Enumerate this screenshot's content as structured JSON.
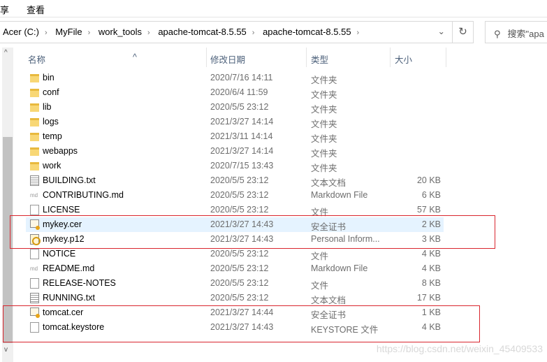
{
  "ribbon": {
    "tabs": [
      "享",
      "查看"
    ]
  },
  "address": {
    "crumbs": [
      "Acer (C:)",
      "MyFile",
      "work_tools",
      "apache-tomcat-8.5.55",
      "apache-tomcat-8.5.55"
    ],
    "search_placeholder": "搜索\"apa"
  },
  "columns": {
    "name": "名称",
    "date": "修改日期",
    "type": "类型",
    "size": "大小"
  },
  "files": [
    {
      "name": "bin",
      "date": "2020/7/16 14:11",
      "type": "文件夹",
      "size": "",
      "icon": "folder"
    },
    {
      "name": "conf",
      "date": "2020/6/4 11:59",
      "type": "文件夹",
      "size": "",
      "icon": "folder"
    },
    {
      "name": "lib",
      "date": "2020/5/5 23:12",
      "type": "文件夹",
      "size": "",
      "icon": "folder"
    },
    {
      "name": "logs",
      "date": "2021/3/27 14:14",
      "type": "文件夹",
      "size": "",
      "icon": "folder"
    },
    {
      "name": "temp",
      "date": "2021/3/11 14:14",
      "type": "文件夹",
      "size": "",
      "icon": "folder"
    },
    {
      "name": "webapps",
      "date": "2021/3/27 14:14",
      "type": "文件夹",
      "size": "",
      "icon": "folder"
    },
    {
      "name": "work",
      "date": "2020/7/15 13:43",
      "type": "文件夹",
      "size": "",
      "icon": "folder"
    },
    {
      "name": "BUILDING.txt",
      "date": "2020/5/5 23:12",
      "type": "文本文档",
      "size": "20 KB",
      "icon": "txt"
    },
    {
      "name": "CONTRIBUTING.md",
      "date": "2020/5/5 23:12",
      "type": "Markdown File",
      "size": "6 KB",
      "icon": "md"
    },
    {
      "name": "LICENSE",
      "date": "2020/5/5 23:12",
      "type": "文件",
      "size": "57 KB",
      "icon": "file"
    },
    {
      "name": "mykey.cer",
      "date": "2021/3/27 14:43",
      "type": "安全证书",
      "size": "2 KB",
      "icon": "cert"
    },
    {
      "name": "mykey.p12",
      "date": "2021/3/27 14:43",
      "type": "Personal Inform...",
      "size": "3 KB",
      "icon": "p12"
    },
    {
      "name": "NOTICE",
      "date": "2020/5/5 23:12",
      "type": "文件",
      "size": "4 KB",
      "icon": "file"
    },
    {
      "name": "README.md",
      "date": "2020/5/5 23:12",
      "type": "Markdown File",
      "size": "4 KB",
      "icon": "md"
    },
    {
      "name": "RELEASE-NOTES",
      "date": "2020/5/5 23:12",
      "type": "文件",
      "size": "8 KB",
      "icon": "file"
    },
    {
      "name": "RUNNING.txt",
      "date": "2020/5/5 23:12",
      "type": "文本文档",
      "size": "17 KB",
      "icon": "txt"
    },
    {
      "name": "tomcat.cer",
      "date": "2021/3/27 14:44",
      "type": "安全证书",
      "size": "1 KB",
      "icon": "cert"
    },
    {
      "name": "tomcat.keystore",
      "date": "2021/3/27 14:43",
      "type": "KEYSTORE 文件",
      "size": "4 KB",
      "icon": "file"
    }
  ],
  "watermark": "https://blog.csdn.net/weixin_45409533"
}
